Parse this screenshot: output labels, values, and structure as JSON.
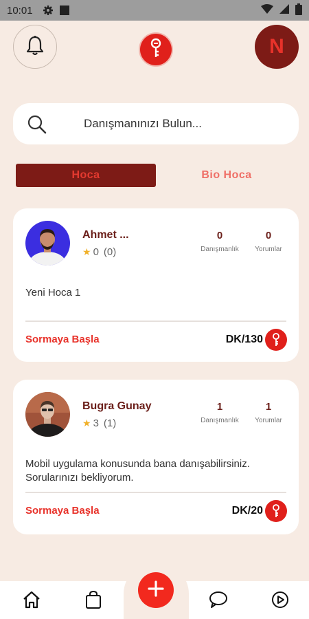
{
  "status_bar": {
    "time": "10:01",
    "icons": [
      "gear-icon",
      "square-icon",
      "wifi-icon",
      "signal-icon",
      "battery-icon"
    ]
  },
  "header": {
    "avatar_initial": "N",
    "icons": [
      "bell-icon",
      "key-logo-icon"
    ]
  },
  "search": {
    "placeholder": "Danışmanınızı Bulun..."
  },
  "tabs": [
    {
      "label": "Hoca",
      "active": true
    },
    {
      "label": "Bio Hoca",
      "active": false
    }
  ],
  "cards": [
    {
      "name": "Ahmet ...",
      "rating": "0",
      "reviews": "(0)",
      "consult_count": "0",
      "consult_label": "Danışmanlık",
      "comments_count": "0",
      "comments_label": "Yorumlar",
      "description": "Yeni Hoca 1",
      "cta": "Sormaya Başla",
      "price": "DK/130"
    },
    {
      "name": "Bugra Gunay",
      "rating": "3",
      "reviews": "(1)",
      "consult_count": "1",
      "consult_label": "Danışmanlık",
      "comments_count": "1",
      "comments_label": "Yorumlar",
      "description": "Mobil uygulama konusunda bana danışabilirsiniz. Sorularınızı bekliyorum.",
      "cta": "Sormaya Başla",
      "price": "DK/20"
    }
  ],
  "bottom_nav": {
    "items": [
      "home-icon",
      "shopping-bag-icon",
      "add-icon",
      "chat-icon",
      "settings-icon"
    ]
  },
  "colors": {
    "background": "#f7ebe3",
    "primary_red": "#e0201b",
    "dark_red": "#7d1b16",
    "accent_pink": "#ef6f67",
    "star": "#f1b12b"
  }
}
